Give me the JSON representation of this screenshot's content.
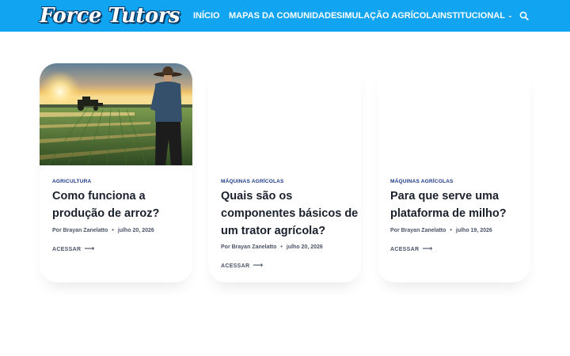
{
  "header": {
    "logo_text": "Force Tutors",
    "nav": [
      {
        "label": "INÍCIO"
      },
      {
        "label": "MAPAS DA COMUNIDADE"
      },
      {
        "label": "SIMULAÇÃO AGRÍCOLA"
      },
      {
        "label": "INSTITUCIONAL",
        "has_dropdown": true
      }
    ],
    "search_icon": "search-icon",
    "colors": {
      "bar": "#11a4f1",
      "text": "#ffffff"
    }
  },
  "posts": [
    {
      "category": "AGRICULTURA",
      "title": "Como funciona a produção de arroz?",
      "author": "Por Brayan Zanelatto",
      "date": "julho 20, 2026",
      "cta": "ACESSAR",
      "has_image": true
    },
    {
      "category": "MÁQUINAS AGRÍCOLAS",
      "title": "Quais são os componentes básicos de um trator agrícola?",
      "author": "Por Brayan Zanelatto",
      "date": "julho 20, 2026",
      "cta": "ACESSAR",
      "has_image": false
    },
    {
      "category": "MÁQUINAS AGRÍCOLAS",
      "title": "Para que serve uma plataforma de milho?",
      "author": "Por Brayan Zanelatto",
      "date": "julho 19, 2026",
      "cta": "ACESSAR",
      "has_image": false
    }
  ],
  "colors": {
    "category": "#1e3a8a",
    "title": "#1a202c",
    "meta": "#4a5568"
  }
}
